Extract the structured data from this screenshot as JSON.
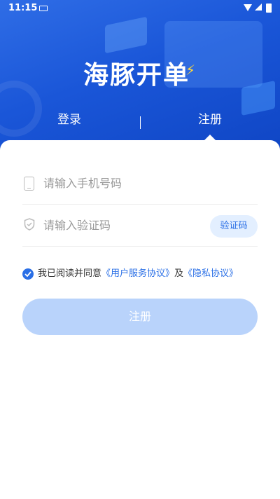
{
  "status_bar": {
    "time": "11:15"
  },
  "header": {
    "logo_text": "海豚开单",
    "logo_accent": "⚡"
  },
  "tabs": [
    {
      "label": "登录"
    },
    {
      "label": "注册"
    }
  ],
  "form": {
    "phone_placeholder": "请输入手机号码",
    "code_placeholder": "请输入验证码",
    "get_code_label": "验证码",
    "agree_prefix": "我已阅读并同意",
    "agree_link_service": "《用户服务协议》",
    "agree_and": "及",
    "agree_link_privacy": "《隐私协议》",
    "agree_checked": true,
    "submit_label": "注册"
  },
  "colors": {
    "primary": "#2a6fe6",
    "header_bg": "#1a56d8",
    "button_disabled": "#b9d3fb",
    "accent_bolt": "#ffd83a"
  },
  "icons": [
    "keyboard-icon",
    "wifi-icon",
    "signal-icon",
    "battery-icon",
    "phone-icon",
    "shield-icon",
    "check-icon"
  ]
}
